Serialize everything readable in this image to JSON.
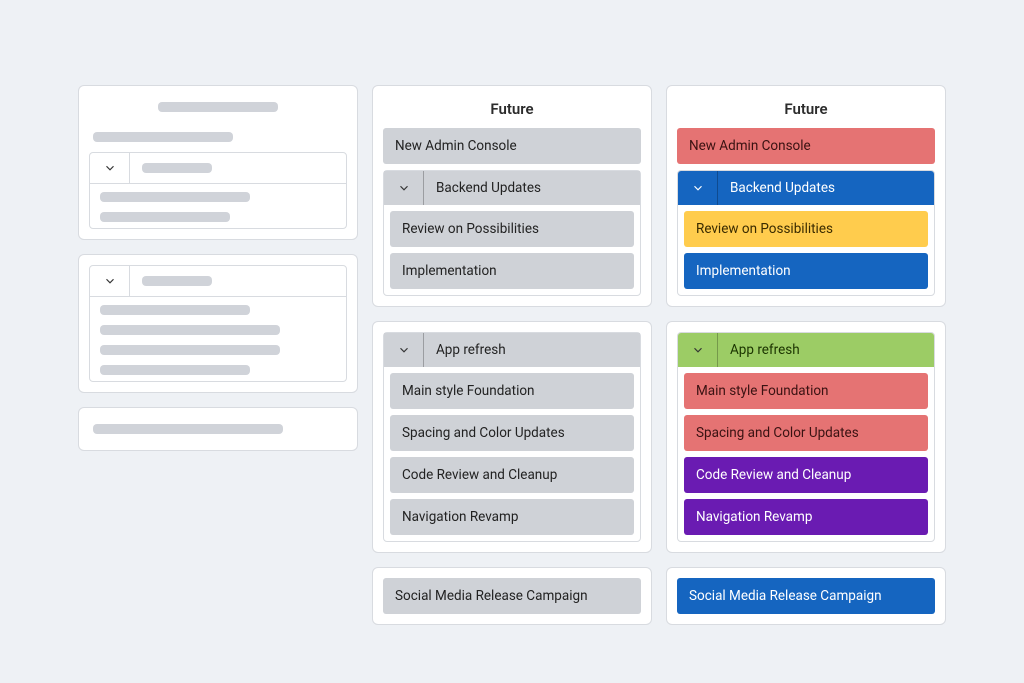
{
  "columns": {
    "skeleton": {
      "section1_rows": 2,
      "section2_rows": 4
    },
    "gray": {
      "title": "Future",
      "panel1": {
        "item1": "New Admin Console",
        "group1": {
          "label": "Backend Updates",
          "children": [
            "Review on Possibilities",
            "Implementation"
          ]
        }
      },
      "panel2": {
        "group": {
          "label": "App refresh",
          "children": [
            "Main style Foundation",
            "Spacing and Color Updates",
            "Code Review and Cleanup",
            "Navigation Revamp"
          ]
        }
      },
      "panel3": {
        "item": "Social Media Release Campaign"
      }
    },
    "color": {
      "title": "Future",
      "panel1": {
        "item1": {
          "label": "New Admin Console",
          "color": "red"
        },
        "group1": {
          "label": "Backend Updates",
          "color": "blue",
          "children": [
            {
              "label": "Review on Possibilities",
              "color": "yellow"
            },
            {
              "label": "Implementation",
              "color": "blue"
            }
          ]
        }
      },
      "panel2": {
        "group": {
          "label": "App refresh",
          "color": "green",
          "children": [
            {
              "label": "Main style Foundation",
              "color": "red"
            },
            {
              "label": "Spacing and Color Updates",
              "color": "red"
            },
            {
              "label": "Code Review and Cleanup",
              "color": "purple"
            },
            {
              "label": "Navigation Revamp",
              "color": "purple"
            }
          ]
        }
      },
      "panel3": {
        "item": {
          "label": "Social Media Release Campaign",
          "color": "blue"
        }
      }
    }
  }
}
